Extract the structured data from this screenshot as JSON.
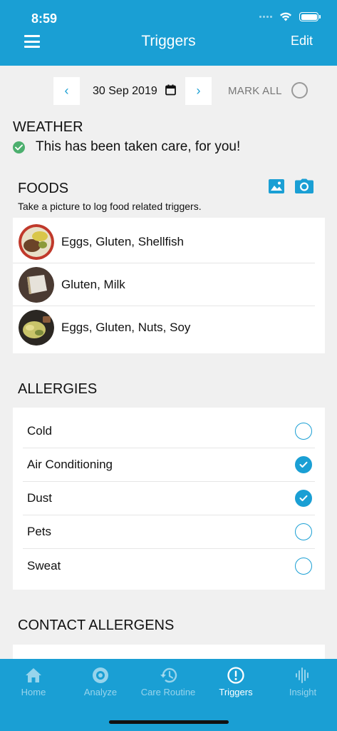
{
  "status": {
    "time": "8:59"
  },
  "header": {
    "title": "Triggers",
    "edit_label": "Edit"
  },
  "datebar": {
    "prev": "‹",
    "date": "30 Sep 2019",
    "next": "›",
    "mark_all": "MARK ALL"
  },
  "weather": {
    "title": "WEATHER",
    "message": "This has been taken care, for you!"
  },
  "foods": {
    "title": "FOODS",
    "subtitle": "Take a picture to log food related triggers.",
    "items": [
      {
        "label": "Eggs, Gluten, Shellfish"
      },
      {
        "label": "Gluten, Milk"
      },
      {
        "label": "Eggs, Gluten, Nuts, Soy"
      }
    ]
  },
  "allergies": {
    "title": "ALLERGIES",
    "items": [
      {
        "label": "Cold",
        "checked": false
      },
      {
        "label": "Air Conditioning",
        "checked": true
      },
      {
        "label": "Dust",
        "checked": true
      },
      {
        "label": "Pets",
        "checked": false
      },
      {
        "label": "Sweat",
        "checked": false
      }
    ]
  },
  "contact_allergens": {
    "title": "CONTACT ALLERGENS"
  },
  "tabs": [
    {
      "label": "Home",
      "icon": "home-icon",
      "active": false
    },
    {
      "label": "Analyze",
      "icon": "analyze-icon",
      "active": false
    },
    {
      "label": "Care Routine",
      "icon": "history-icon",
      "active": false
    },
    {
      "label": "Triggers",
      "icon": "alert-icon",
      "active": true
    },
    {
      "label": "Insight",
      "icon": "waveform-icon",
      "active": false
    }
  ],
  "colors": {
    "primary": "#1a9fd4",
    "success": "#4caf6e",
    "background": "#f0f0f0"
  }
}
